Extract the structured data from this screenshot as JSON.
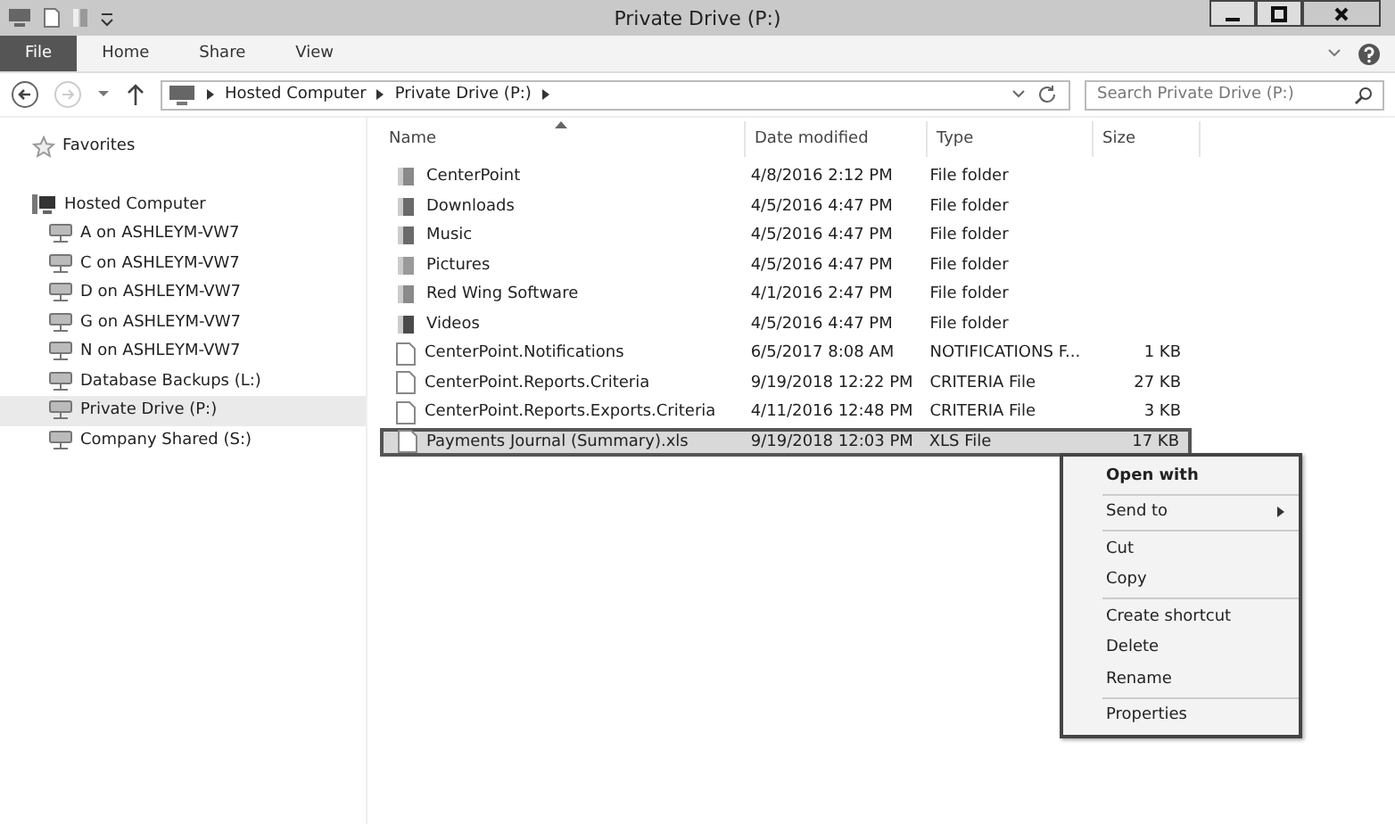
{
  "window": {
    "title": "Private Drive (P:)"
  },
  "ribbon_tabs": [
    {
      "label": "File",
      "selected": true
    },
    {
      "label": "Home",
      "selected": false
    },
    {
      "label": "Share",
      "selected": false
    },
    {
      "label": "View",
      "selected": false
    }
  ],
  "address": {
    "breadcrumbs": [
      "Hosted Computer",
      "Private Drive (P:)"
    ]
  },
  "search": {
    "placeholder": "Search Private Drive (P:)"
  },
  "sidebar": {
    "favorites": "Favorites",
    "computer": "Hosted Computer",
    "items": [
      {
        "label": "A on ASHLEYM-VW7",
        "selected": false
      },
      {
        "label": "C on ASHLEYM-VW7",
        "selected": false
      },
      {
        "label": "D on ASHLEYM-VW7",
        "selected": false
      },
      {
        "label": "G on ASHLEYM-VW7",
        "selected": false
      },
      {
        "label": "N on ASHLEYM-VW7",
        "selected": false
      },
      {
        "label": "Database Backups (L:)",
        "selected": false
      },
      {
        "label": "Private Drive (P:)",
        "selected": true
      },
      {
        "label": "Company Shared (S:)",
        "selected": false
      }
    ]
  },
  "table": {
    "columns": [
      "Name",
      "Date modified",
      "Type",
      "Size"
    ],
    "rows": [
      {
        "kind": "folder",
        "name": "CenterPoint",
        "date": "4/8/2016 2:12 PM",
        "type": "File folder",
        "selected": false
      },
      {
        "kind": "downloads",
        "name": "Downloads",
        "date": "4/5/2016 4:47 PM",
        "type": "File folder",
        "selected": false
      },
      {
        "kind": "music",
        "name": "Music",
        "date": "4/5/2016 4:47 PM",
        "type": "File folder",
        "selected": false
      },
      {
        "kind": "pictures",
        "name": "Pictures",
        "date": "4/5/2016 4:47 PM",
        "type": "File folder",
        "selected": false
      },
      {
        "kind": "folder",
        "name": "Red Wing Software",
        "date": "4/1/2016 2:47 PM",
        "type": "File folder",
        "selected": false
      },
      {
        "kind": "videos",
        "name": "Videos",
        "date": "4/5/2016 4:47 PM",
        "type": "File folder",
        "selected": false
      },
      {
        "kind": "file",
        "name": "CenterPoint.Notifications",
        "date": "6/5/2017 8:08 AM",
        "type": "NOTIFICATIONS F...",
        "size": "1 KB",
        "selected": false
      },
      {
        "kind": "file",
        "name": "CenterPoint.Reports.Criteria",
        "date": "9/19/2018 12:22 PM",
        "type": "CRITERIA File",
        "size": "27 KB",
        "selected": false
      },
      {
        "kind": "file",
        "name": "CenterPoint.Reports.Exports.Criteria",
        "date": "4/11/2016 12:48 PM",
        "type": "CRITERIA File",
        "size": "3 KB",
        "selected": false
      },
      {
        "kind": "file",
        "name": "Payments Journal (Summary).xls",
        "date": "9/19/2018 12:03 PM",
        "type": "XLS File",
        "size": "17 KB",
        "selected": true
      }
    ]
  },
  "context_menu": {
    "groups": [
      [
        {
          "label": "Open with",
          "bold": true,
          "submenu": false
        }
      ],
      [
        {
          "label": "Send to",
          "bold": false,
          "submenu": true
        }
      ],
      [
        {
          "label": "Cut",
          "bold": false,
          "submenu": false
        },
        {
          "label": "Copy",
          "bold": false,
          "submenu": false
        }
      ],
      [
        {
          "label": "Create shortcut",
          "bold": false,
          "submenu": false
        },
        {
          "label": "Delete",
          "bold": false,
          "submenu": false
        },
        {
          "label": "Rename",
          "bold": false,
          "submenu": false
        }
      ],
      [
        {
          "label": "Properties",
          "bold": false,
          "submenu": false
        }
      ]
    ]
  }
}
